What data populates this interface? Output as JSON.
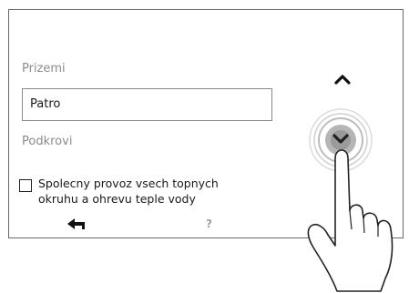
{
  "levels": {
    "items": [
      "Prizemi",
      "Patro",
      "Podkrovi"
    ],
    "selected": "Patro"
  },
  "option": {
    "label_line1": "Spolecny provoz vsech topnych",
    "label_line2": "okruhu a ohrevu teple vody",
    "checked": false
  },
  "footer": {
    "help_label": "?"
  },
  "icons": {
    "scroll_up": "chevron-up-icon",
    "scroll_down": "chevron-down-icon",
    "back": "back-arrow-icon",
    "help": "question-icon"
  },
  "colors": {
    "text": "#1a1a1a",
    "muted": "#8c8c8c",
    "border": "#6a6a6a"
  }
}
